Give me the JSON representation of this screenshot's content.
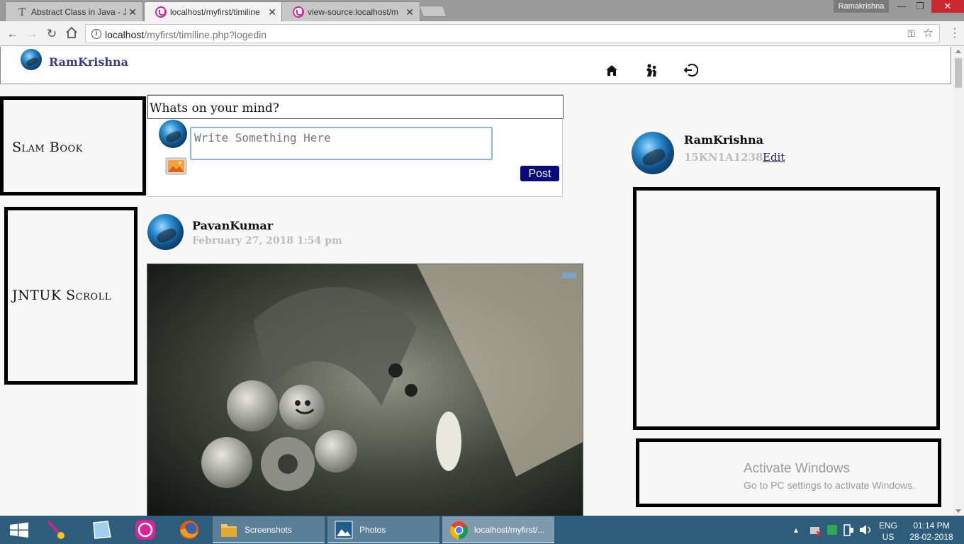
{
  "browser": {
    "tabs": [
      {
        "label": "Abstract Class in Java - Ja",
        "favicon": "text-t-icon",
        "active": false
      },
      {
        "label": "localhost/myfirst/timiline",
        "favicon": "wamp-icon",
        "active": true
      },
      {
        "label": "view-source:localhost/m",
        "favicon": "wamp-icon",
        "active": false
      }
    ],
    "close_glyph": "✕",
    "profile_name": "Ramakrishna",
    "url_host": "localhost",
    "url_path": "/myfirst/timiline.php?logedin"
  },
  "site": {
    "brand": "RamKrishna",
    "nav": [
      "home-icon",
      "friends-icon",
      "logout-icon"
    ]
  },
  "left_boxes": [
    "Slam Book",
    "JNTUK Scroll"
  ],
  "composer": {
    "prompt": "Whats on your mind?",
    "placeholder": "Write Something Here",
    "post_label": "Post"
  },
  "post": {
    "author": "PavanKumar",
    "time": "February 27, 2018 1:54 pm"
  },
  "profile": {
    "name": "RamKrishna",
    "id": "15KN1A1238",
    "edit_label": "Edit"
  },
  "watermark": {
    "title": "Activate Windows",
    "subtitle": "Go to PC settings to activate Windows."
  },
  "taskbar": {
    "items": [
      {
        "label": "Screenshots",
        "icon": "folder-icon"
      },
      {
        "label": "Photos",
        "icon": "photos-icon"
      },
      {
        "label": "localhost/myfirst/...",
        "icon": "chrome-icon"
      }
    ],
    "lang_top": "ENG",
    "lang_bottom": "US",
    "time": "01:14 PM",
    "date": "28-02-2018"
  }
}
